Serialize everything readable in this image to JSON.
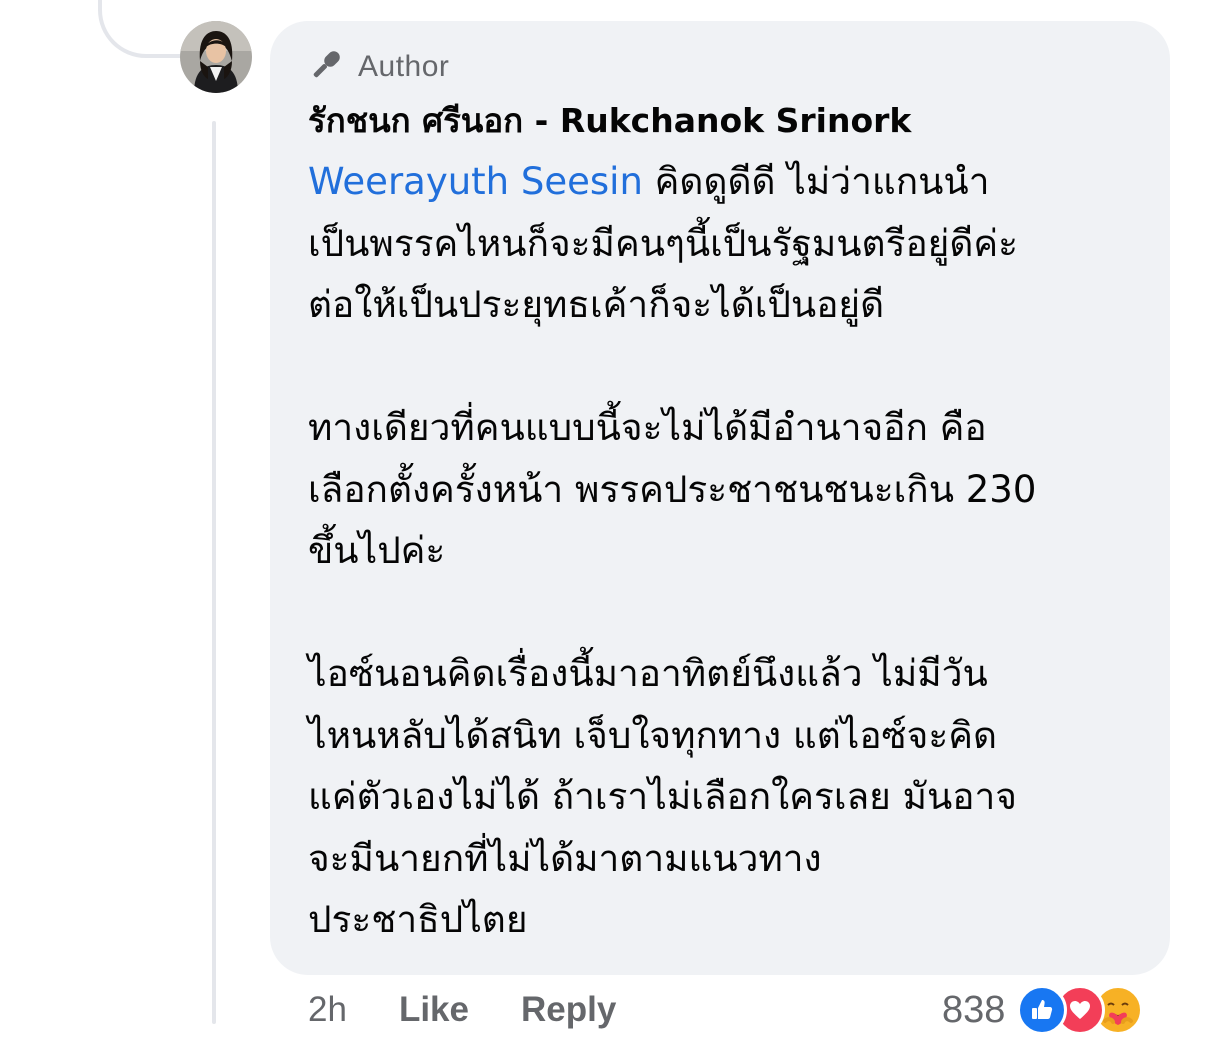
{
  "comment": {
    "author_badge": "Author",
    "name": "รักชนก ศรีนอก - Rukchanok Srinork",
    "mention": "Weerayuth Seesin",
    "paragraphs": [
      {
        "first_line_rest": " คิดดูดีดี ไม่ว่าแกนนำ",
        "lines": [
          "เป็นพรรคไหนก็จะมีคนๆนี้เป็นรัฐมนตรีอยู่ดีค่ะ",
          "ต่อให้เป็นประยุทธเค้าก็จะได้เป็นอยู่ดี"
        ]
      },
      {
        "lines": [
          "ทางเดียวที่คนแบบนี้จะไม่ได้มีอำนาจอีก คือ",
          "เลือกตั้งครั้งหน้า พรรคประชาชนชนะเกิน 230",
          "ขึ้นไปค่ะ"
        ]
      },
      {
        "lines": [
          "ไอซ์นอนคิดเรื่องนี้มาอาทิตย์นึงแล้ว ไม่มีวัน",
          "ไหนหลับได้สนิท เจ็บใจทุกทาง แต่ไอซ์จะคิด",
          "แค่ตัวเองไม่ได้ ถ้าเราไม่เลือกใครเลย มันอาจ",
          "จะมีนายกที่ไม่ได้มาตามแนวทาง",
          "ประชาธิปไตย"
        ]
      }
    ],
    "timestamp": "2h",
    "like_label": "Like",
    "reply_label": "Reply",
    "reaction_count": "838",
    "reactions": [
      "like-icon",
      "love-icon",
      "care-icon"
    ]
  },
  "colors": {
    "bubble": "#f0f2f5",
    "mention": "#216fdb",
    "secondary_text": "#65676b",
    "thread_line": "#e4e6eb"
  }
}
